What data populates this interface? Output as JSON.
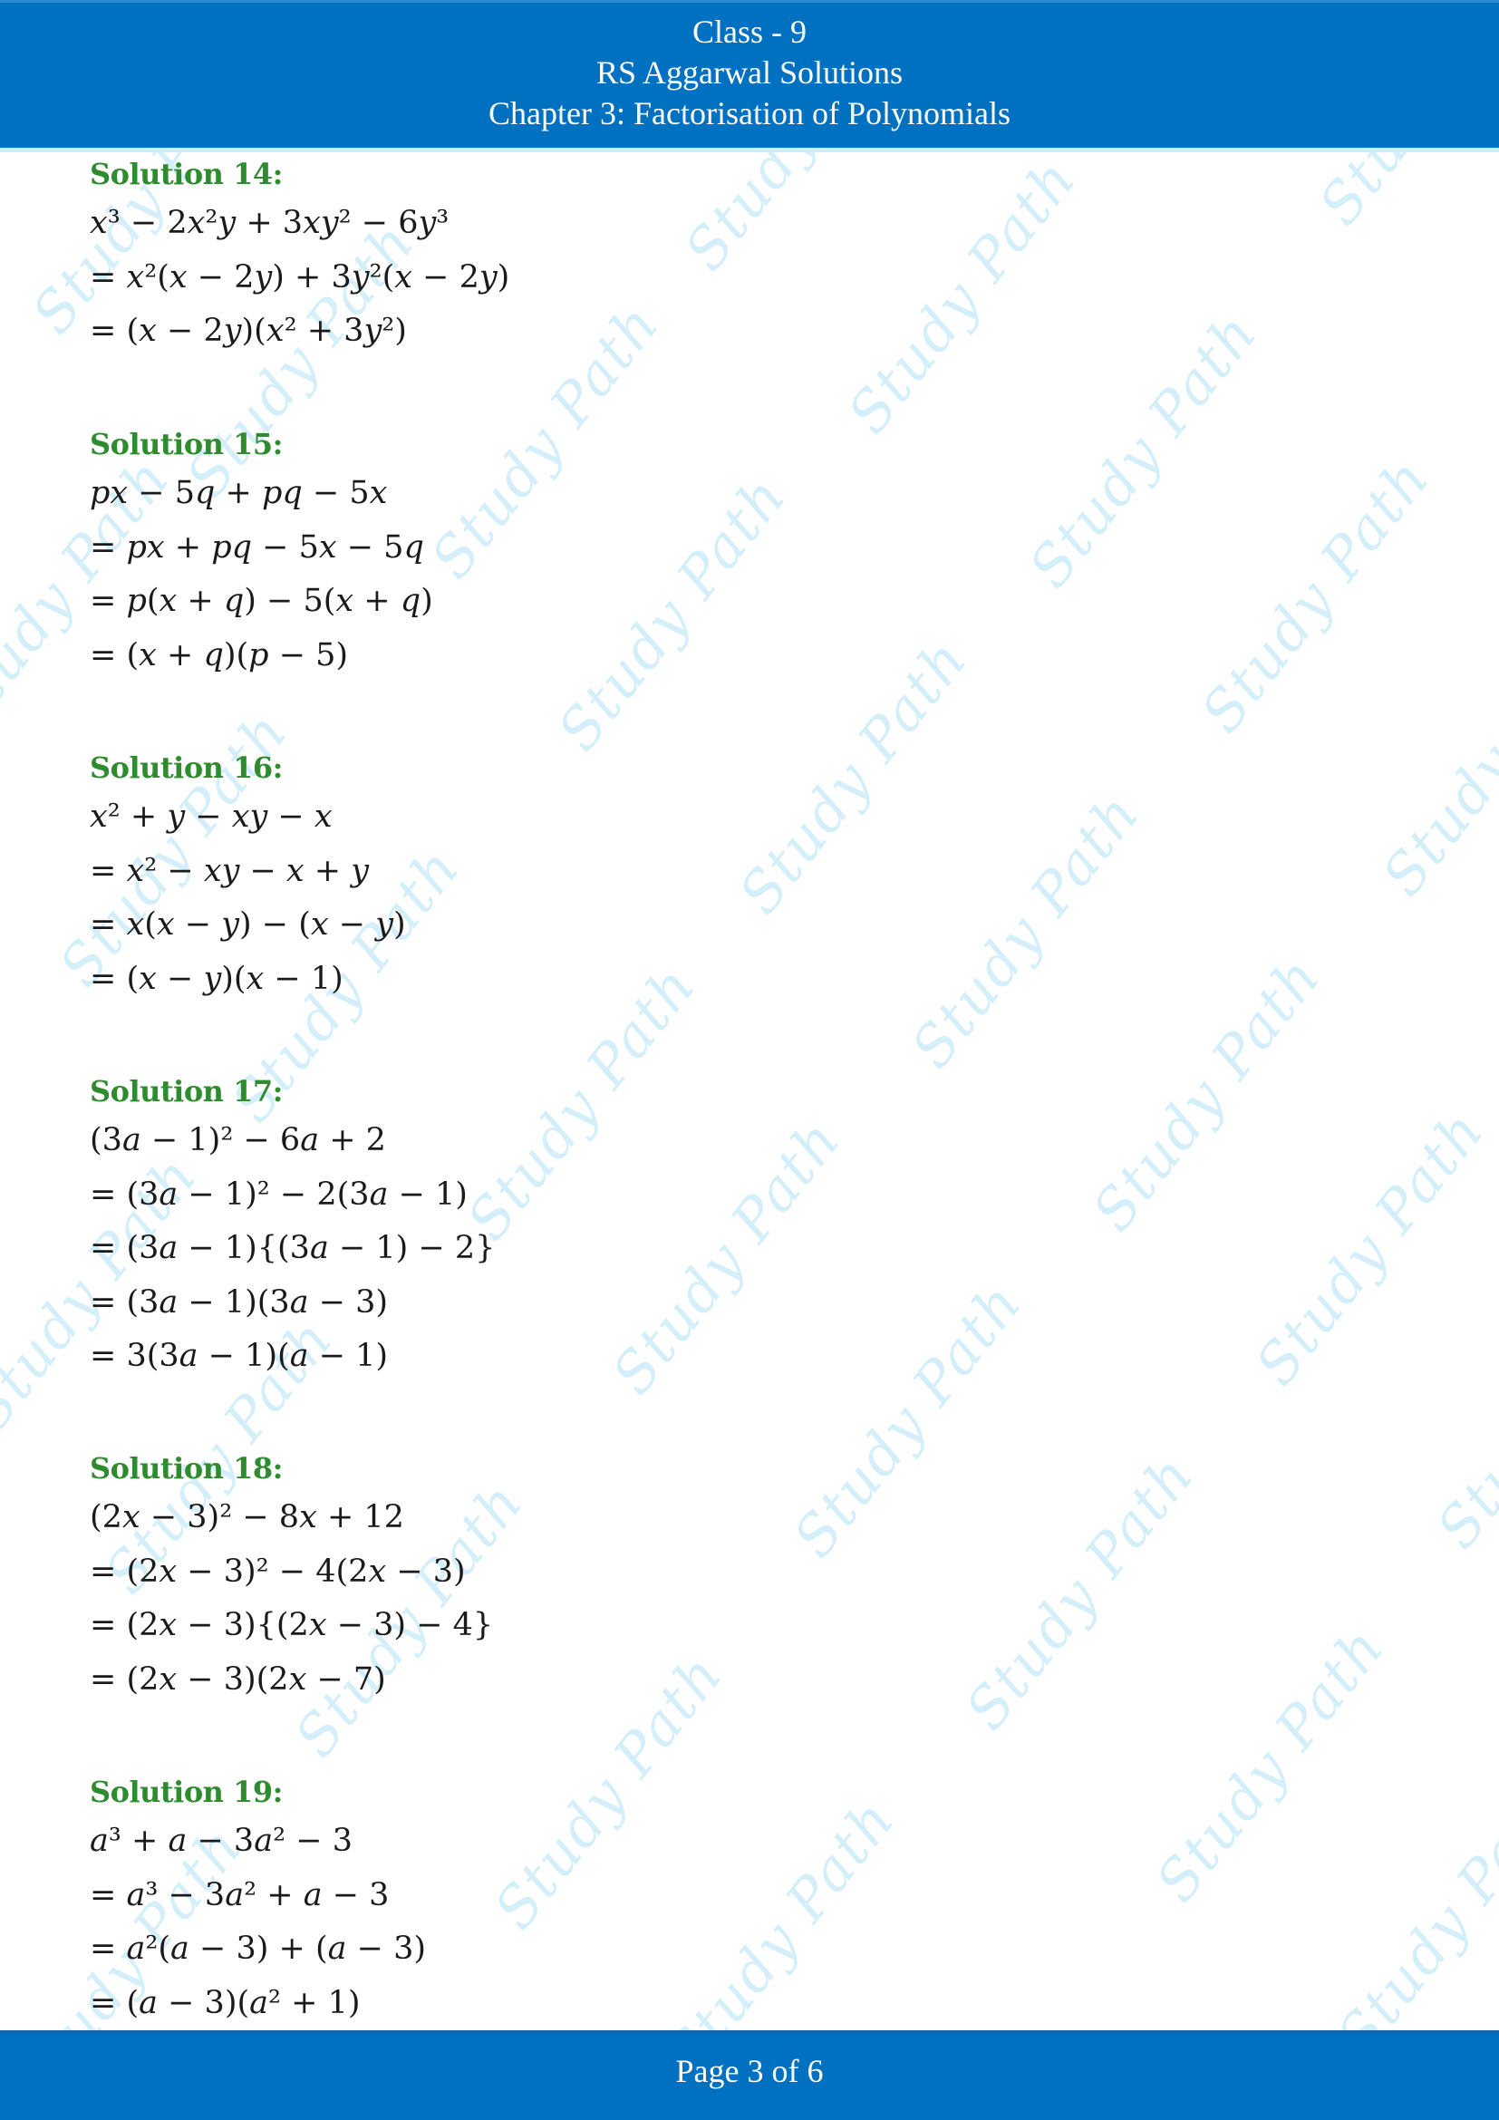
{
  "header": {
    "class_label": "Class - 9",
    "book_title": "RS Aggarwal Solutions",
    "chapter_title": "Chapter 3: Factorisation of Polynomials"
  },
  "footer": {
    "page_label": "Page 3 of 6",
    "current_page": 3,
    "total_pages": 6
  },
  "watermark": {
    "text": "Study Path",
    "color": "#d4effa"
  },
  "colors": {
    "header_bg": "#0070c0",
    "solution_title": "#2e8b2e"
  },
  "solutions": [
    {
      "title": "Solution 14:",
      "lines": [
        "x³ − 2x²y + 3xy² − 6y³",
        "= x²(x − 2y) + 3y²(x − 2y)",
        "= (x − 2y)(x² + 3y²)"
      ]
    },
    {
      "title": "Solution 15:",
      "lines": [
        "px − 5q + pq − 5x",
        "= px + pq − 5x − 5q",
        "= p(x + q) − 5(x + q)",
        "= (x + q)(p − 5)"
      ]
    },
    {
      "title": "Solution 16:",
      "lines": [
        "x² + y − xy − x",
        "= x² − xy − x + y",
        "= x(x − y) − (x − y)",
        "= (x − y)(x − 1)"
      ]
    },
    {
      "title": "Solution 17:",
      "lines": [
        "(3a − 1)² − 6a + 2",
        "= (3a − 1)² − 2(3a − 1)",
        "= (3a − 1){(3a − 1) − 2}",
        "= (3a − 1)(3a − 3)",
        "= 3(3a − 1)(a − 1)"
      ]
    },
    {
      "title": "Solution 18:",
      "lines": [
        "(2x − 3)² − 8x + 12",
        "= (2x − 3)² − 4(2x − 3)",
        "= (2x − 3){(2x − 3) − 4}",
        "= (2x − 3)(2x − 7)"
      ]
    },
    {
      "title": "Solution 19:",
      "lines": [
        "a³ + a − 3a² − 3",
        "= a³ − 3a² + a − 3",
        "= a²(a − 3) + (a − 3)",
        "= (a − 3)(a² + 1)"
      ]
    }
  ]
}
